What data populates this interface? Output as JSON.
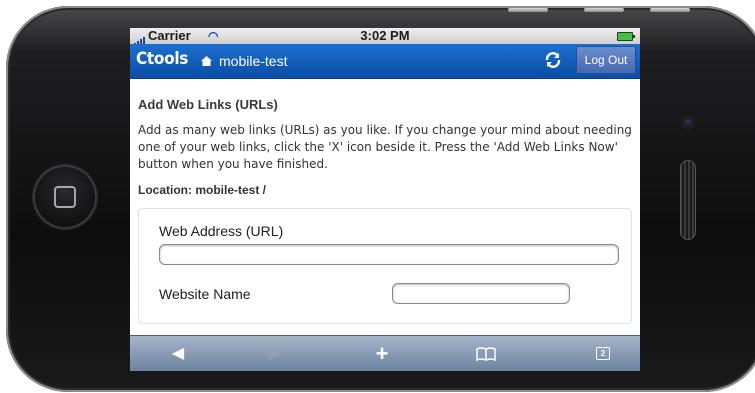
{
  "status_bar": {
    "carrier": "Carrier",
    "time": "3:02 PM"
  },
  "app_bar": {
    "brand": "Ctools",
    "site": "mobile-test",
    "logout_label": "Log Out",
    "icons": [
      "home-icon",
      "sync-icon"
    ]
  },
  "page": {
    "title": "Add Web Links (URLs)",
    "instructions": "Add as many web links (URLs) as you like. If you change your mind about needing one of your web links, click the 'X' icon beside it. Press the 'Add Web Links Now' button when you have finished.",
    "location": "Location: mobile-test /"
  },
  "form": {
    "url_label": "Web Address (URL)",
    "url_value": "",
    "name_label": "Website Name",
    "name_value": ""
  },
  "toolbar": {
    "icons": [
      "back-icon",
      "forward-icon",
      "add-icon",
      "bookmarks-icon",
      "tabs-icon"
    ],
    "tabs_count": "2"
  },
  "colors": {
    "app_bar": "#0b4ea6",
    "toolbar": "#6d83a1",
    "logout_button": "#4366b0"
  }
}
